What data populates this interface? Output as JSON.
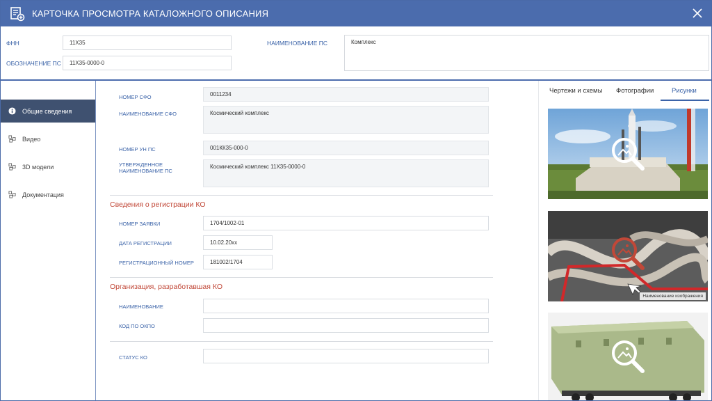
{
  "window": {
    "title": "КАРТОЧКА ПРОСМОТРА КАТАЛОЖНОГО ОПИСАНИЯ"
  },
  "header": {
    "fnn_label": "ФНН",
    "fnn_value": "11Х35",
    "oboz_label": "ОБОЗНАЧЕНИЕ ПС",
    "oboz_value": "11Х35-0000-0",
    "name_label": "НАИМЕНОВАНИЕ ПС",
    "name_value": "Комплекс"
  },
  "sidebar": {
    "items": [
      {
        "label": "Общие сведения",
        "icon": "info-icon",
        "active": true
      },
      {
        "label": "Видео",
        "icon": "nodes-icon",
        "active": false
      },
      {
        "label": "3D модели",
        "icon": "nodes-icon",
        "active": false
      },
      {
        "label": "Документация",
        "icon": "nodes-icon",
        "active": false
      }
    ]
  },
  "main": {
    "general": {
      "nomer_sfo_label": "НОМЕР СФО",
      "nomer_sfo_value": "0011234",
      "name_sfo_label": "НАИМЕНОВАНИЕ СФО",
      "name_sfo_value": "Космический комплекс",
      "nomer_un_label": "НОМЕР УН ПС",
      "nomer_un_value": "001КК35-000-0",
      "approved_label_1": "УТВЕРЖДЕННОЕ",
      "approved_label_2": "НАИМЕНОВАНИЕ ПС",
      "approved_value": "Космический комплекс 11Х35-0000-0"
    },
    "registration": {
      "title": "Сведения о регистрации КО",
      "zayavka_label": "НОМЕР ЗАЯВКИ",
      "zayavka_value": "1704/1002-01",
      "date_label": "ДАТА РЕГИСТРАЦИИ",
      "date_value": "10.02.20хх",
      "regnum_label": "РЕГИСТРАЦИОННЫЙ НОМЕР",
      "regnum_value": "181002/1704"
    },
    "organization": {
      "title": "Организация, разработавшая КО",
      "name_label": "НАИМЕНОВАНИЕ",
      "name_value": "",
      "okpo_label": "КОД ПО ОКПО",
      "okpo_value": ""
    },
    "status": {
      "label": "СТАТУС КО",
      "value": ""
    }
  },
  "right": {
    "tabs": [
      {
        "label": "Чертежи и схемы",
        "active": false
      },
      {
        "label": "Фотографии",
        "active": false
      },
      {
        "label": "Рисунки",
        "active": true
      }
    ],
    "images": [
      {
        "icon": "zoom-image-icon"
      },
      {
        "icon": "zoom-image-icon",
        "caption": "Наименование изображения"
      },
      {
        "icon": "zoom-image-icon"
      }
    ]
  },
  "colors": {
    "titlebar": "#4b6cad",
    "accent": "#3b63a8",
    "section": "#c14838",
    "nav_active": "#3f5170"
  }
}
